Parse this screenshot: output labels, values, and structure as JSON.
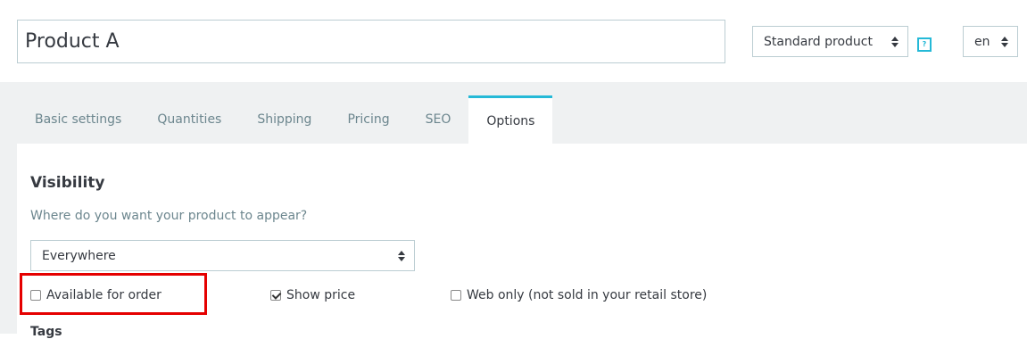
{
  "header": {
    "product_name": "Product A",
    "product_type": "Standard product",
    "help_icon_label": "?",
    "language": "en"
  },
  "tabs": [
    {
      "label": "Basic settings",
      "active": false
    },
    {
      "label": "Quantities",
      "active": false
    },
    {
      "label": "Shipping",
      "active": false
    },
    {
      "label": "Pricing",
      "active": false
    },
    {
      "label": "SEO",
      "active": false
    },
    {
      "label": "Options",
      "active": true
    }
  ],
  "options": {
    "visibility_title": "Visibility",
    "visibility_question": "Where do you want your product to appear?",
    "visibility_value": "Everywhere",
    "available_for_order_label": "Available for order",
    "available_for_order_checked": false,
    "show_price_label": "Show price",
    "show_price_checked": true,
    "web_only_label": "Web only (not sold in your retail store)",
    "web_only_checked": false,
    "tags_label": "Tags"
  },
  "colors": {
    "accent": "#25b9d7",
    "highlight": "#e50000",
    "tab_bar_bg": "#eff1f2"
  }
}
